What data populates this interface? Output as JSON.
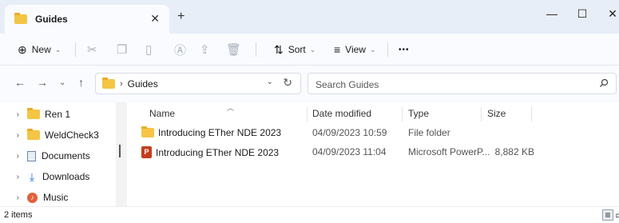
{
  "window": {
    "tab_title": "Guides",
    "tab_close": "✕",
    "new_tab": "+",
    "minimize": "—",
    "maximize": "☐",
    "close": "✕"
  },
  "toolbar": {
    "new_label": "New",
    "sort_label": "Sort",
    "view_label": "View",
    "more_label": "•••"
  },
  "nav": {
    "breadcrumb": "Guides",
    "search_placeholder": "Search Guides"
  },
  "sidebar": {
    "items": [
      {
        "label": "Ren 1"
      },
      {
        "label": "WeldCheck3"
      },
      {
        "label": "Documents"
      },
      {
        "label": "Downloads"
      },
      {
        "label": "Music"
      }
    ]
  },
  "columns": {
    "name": "Name",
    "date": "Date modified",
    "type": "Type",
    "size": "Size"
  },
  "files": [
    {
      "name": "Introducing ETher NDE 2023",
      "date": "04/09/2023 10:59",
      "type": "File folder",
      "size": "",
      "icon": "folder-icon"
    },
    {
      "name": "Introducing ETher NDE 2023",
      "date": "04/09/2023 11:04",
      "type": "Microsoft PowerP...",
      "size": "8,882 KB",
      "icon": "powerpoint-icon"
    }
  ],
  "status": {
    "item_count": "2 items"
  },
  "colors": {
    "titlebar_bg": "#e8eef7",
    "folder": "#f4c545",
    "powerpoint": "#c43e1c",
    "download_accent": "#1f6fd1"
  }
}
